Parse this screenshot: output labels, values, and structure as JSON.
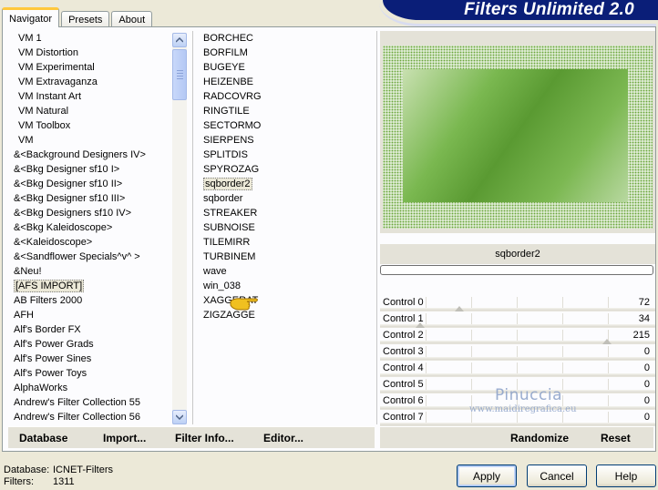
{
  "app": {
    "title": "Filters Unlimited 2.0"
  },
  "tabs": [
    {
      "label": "Navigator",
      "active": true
    },
    {
      "label": "Presets",
      "active": false
    },
    {
      "label": "About",
      "active": false
    }
  ],
  "categories": [
    {
      "label": "VM 1",
      "indent": true
    },
    {
      "label": "VM Distortion",
      "indent": true
    },
    {
      "label": "VM Experimental",
      "indent": true
    },
    {
      "label": "VM Extravaganza",
      "indent": true
    },
    {
      "label": "VM Instant Art",
      "indent": true
    },
    {
      "label": "VM Natural",
      "indent": true
    },
    {
      "label": "VM Toolbox",
      "indent": true
    },
    {
      "label": "VM",
      "indent": true
    },
    {
      "label": "&<Background Designers IV>",
      "indent": false
    },
    {
      "label": "&<Bkg Designer sf10 I>",
      "indent": false
    },
    {
      "label": "&<Bkg Designer sf10 II>",
      "indent": false
    },
    {
      "label": "&<Bkg Designer sf10 III>",
      "indent": false
    },
    {
      "label": "&<Bkg Designers sf10 IV>",
      "indent": false
    },
    {
      "label": "&<Bkg Kaleidoscope>",
      "indent": false
    },
    {
      "label": "&<Kaleidoscope>",
      "indent": false
    },
    {
      "label": "&<Sandflower Specials^v^ >",
      "indent": false
    },
    {
      "label": "&Neu!",
      "indent": false
    },
    {
      "label": "[AFS IMPORT]",
      "indent": false,
      "selected": true
    },
    {
      "label": "AB Filters 2000",
      "indent": false
    },
    {
      "label": "AFH",
      "indent": false
    },
    {
      "label": "Alf's Border FX",
      "indent": false
    },
    {
      "label": "Alf's Power Grads",
      "indent": false
    },
    {
      "label": "Alf's Power Sines",
      "indent": false
    },
    {
      "label": "Alf's Power Toys",
      "indent": false
    },
    {
      "label": "AlphaWorks",
      "indent": false
    },
    {
      "label": "Andrew's Filter Collection 55",
      "indent": false
    },
    {
      "label": "Andrew's Filter Collection 56",
      "indent": false
    }
  ],
  "filters": [
    {
      "label": "BORCHEC"
    },
    {
      "label": "BORFILM"
    },
    {
      "label": "BUGEYE"
    },
    {
      "label": "HEIZENBE"
    },
    {
      "label": "RADCOVRG"
    },
    {
      "label": "RINGTILE"
    },
    {
      "label": "SECTORMO"
    },
    {
      "label": "SIERPENS"
    },
    {
      "label": "SPLITDIS"
    },
    {
      "label": "SPYROZAG"
    },
    {
      "label": "sqborder2",
      "selected": true
    },
    {
      "label": "sqborder"
    },
    {
      "label": "STREAKER"
    },
    {
      "label": "SUBNOISE"
    },
    {
      "label": "TILEMIRR"
    },
    {
      "label": "TURBINEM"
    },
    {
      "label": "wave"
    },
    {
      "label": "win_038"
    },
    {
      "label": "XAGGERAT"
    },
    {
      "label": "ZIGZAGGE"
    }
  ],
  "preview": {
    "filter_name": "sqborder2"
  },
  "controls": [
    {
      "label": "Control 0",
      "value": "72",
      "fraction": 0.282
    },
    {
      "label": "Control 1",
      "value": "34",
      "fraction": 0.133
    },
    {
      "label": "Control 2",
      "value": "215",
      "fraction": 0.843
    },
    {
      "label": "Control 3",
      "value": "0",
      "fraction": 0
    },
    {
      "label": "Control 4",
      "value": "0",
      "fraction": 0
    },
    {
      "label": "Control 5",
      "value": "0",
      "fraction": 0
    },
    {
      "label": "Control 6",
      "value": "0",
      "fraction": 0
    },
    {
      "label": "Control 7",
      "value": "0",
      "fraction": 0
    }
  ],
  "watermark": {
    "name": "Pinuccia",
    "url": "www.maidiregrafica.eu"
  },
  "links": {
    "database": "Database",
    "import": "Import...",
    "filter_info": "Filter Info...",
    "editor": "Editor...",
    "randomize": "Randomize",
    "reset": "Reset"
  },
  "footer": {
    "database_label": "Database:",
    "database_value": "ICNET-Filters",
    "filters_label": "Filters:",
    "filters_value": "1311"
  },
  "buttons": {
    "apply": "Apply",
    "cancel": "Cancel",
    "help": "Help"
  },
  "colors": {
    "banner": "#0a1e78",
    "tab_accent": "#ffc83c",
    "preview_green": "#5a9a32"
  }
}
